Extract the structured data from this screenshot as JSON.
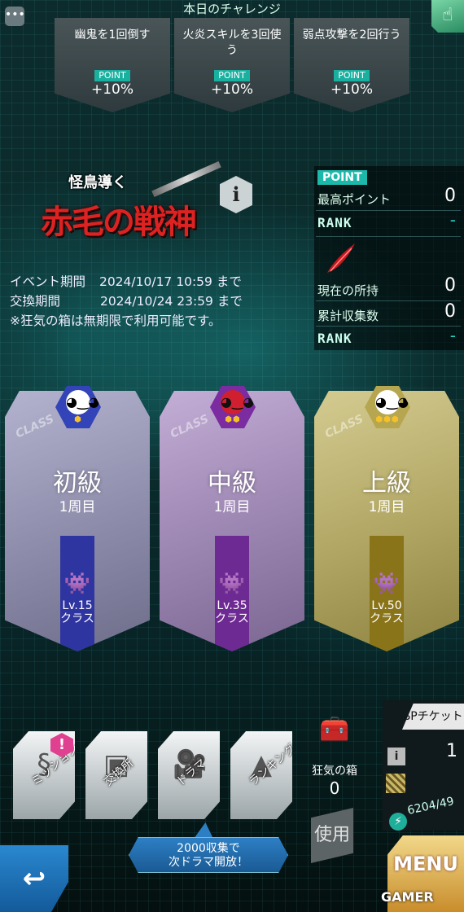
{
  "challenge": {
    "title": "本日のチャレンジ",
    "items": [
      {
        "task": "幽鬼を1回倒す",
        "point_label": "POINT",
        "bonus": "+10%"
      },
      {
        "task": "火炎スキルを3回使う",
        "point_label": "POINT",
        "bonus": "+10%"
      },
      {
        "task": "弱点攻撃を2回行う",
        "point_label": "POINT",
        "bonus": "+10%"
      }
    ]
  },
  "event": {
    "logo_small": "怪鳥導く",
    "logo_main": "赤毛の戦神",
    "info_icon": "i",
    "period_label": "イベント期間",
    "period_value": "2024/10/17 10:59 まで",
    "exchange_label": "交換期間",
    "exchange_value": "2024/10/24 23:59 まで",
    "note": "※狂気の箱は無期限で利用可能です。"
  },
  "stats": {
    "point_badge": "POINT",
    "best_point_label": "最高ポイント",
    "best_point_value": "0",
    "rank_label": "RANK",
    "rank_value": "-",
    "owned_label": "現在の所持",
    "owned_value": "0",
    "collected_label": "累計収集数",
    "collected_value": "0",
    "rank2_label": "RANK",
    "rank2_value": "-"
  },
  "classes": [
    {
      "tag": "CLASS",
      "name": "初級",
      "cycle": "1周目",
      "level": "Lv.15",
      "level_sub": "クラス",
      "color": "#3b3fa0"
    },
    {
      "tag": "CLASS",
      "name": "中級",
      "cycle": "1周目",
      "level": "Lv.35",
      "level_sub": "クラス",
      "color": "#7a2c9c"
    },
    {
      "tag": "CLASS",
      "name": "上級",
      "cycle": "1周目",
      "level": "Lv.50",
      "level_sub": "クラス",
      "color": "#9a8420"
    }
  ],
  "menu": {
    "mission": "ミッション",
    "exchange": "交換所",
    "drama": "ドラマ",
    "ranking": "ランキング",
    "mission_alert": "!",
    "box_label": "狂気の箱",
    "box_value": "0",
    "use_button": "使用",
    "bubble_line1": "2000収集で",
    "bubble_line2": "次ドラマ開放！",
    "back_icon": "back-arrow"
  },
  "sp": {
    "title": "SPチケット",
    "info": "i",
    "value": "1",
    "energy": "6204/49",
    "menu": "MENU"
  },
  "watermark": "GAMER"
}
